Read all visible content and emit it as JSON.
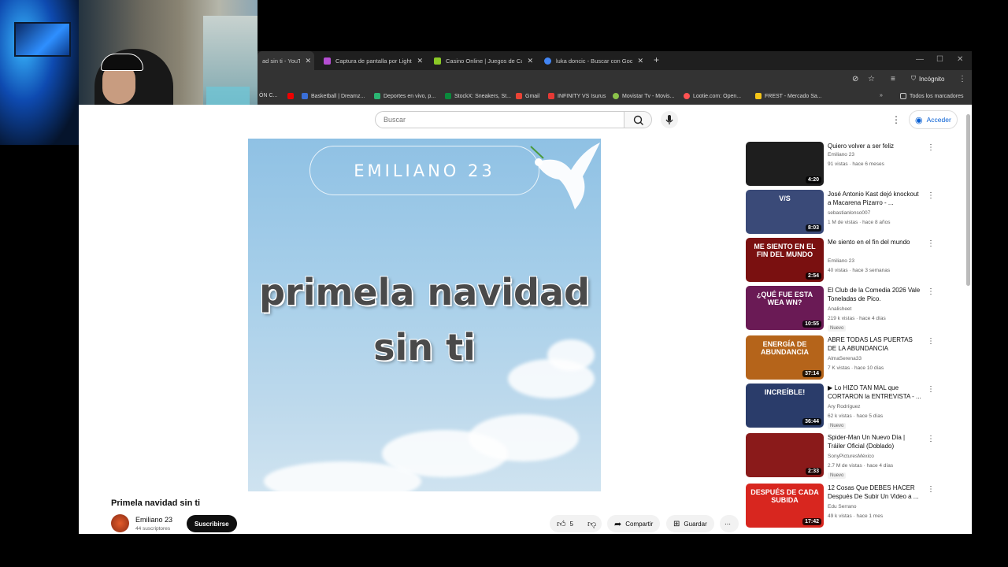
{
  "tabs": [
    {
      "label": "ad sin ti - YouTube",
      "favicon_color": "#ff0000",
      "active": true
    },
    {
      "label": "Captura de pantalla por Lightshot",
      "favicon_color": "#b54ed3",
      "active": false
    },
    {
      "label": "Casino Online | Juegos de Casino",
      "favicon_color": "#8ac926",
      "active": false
    },
    {
      "label": "luka doncic - Buscar con Google",
      "favicon_color": "#4285f4",
      "active": false
    }
  ],
  "incognito_label": "Incógnito",
  "bookmarks": [
    {
      "label": "ÓN C...",
      "color": "#999999"
    },
    {
      "label": "Basketball | Dreamz...",
      "color": "#3a6fd8"
    },
    {
      "label": "Deportes en vivo, p...",
      "color": "#2bb673"
    },
    {
      "label": "StockX: Sneakers, St...",
      "color": "#0a8a3c"
    },
    {
      "label": "Gmail",
      "color": "#ea4335"
    },
    {
      "label": "INFINITY VS Isurus",
      "color": "#e53935"
    },
    {
      "label": "Movistar Tv - Movis...",
      "color": "#8bc34a"
    },
    {
      "label": "Lootie.com: Open...",
      "color": "#ff5252"
    },
    {
      "label": "FREST - Mercado Sa...",
      "color": "#f5c518"
    }
  ],
  "all_bookmarks_label": "Todos los marcadores",
  "search": {
    "placeholder": "Buscar"
  },
  "signin_label": "Acceder",
  "video": {
    "channel_banner": "EMILIANO 23",
    "headline": "primela navidad sin ti",
    "title": "Primela navidad sin ti",
    "channel": "Emiliano 23",
    "subscribers": "44 suscriptores",
    "subscribe_label": "Suscribirse",
    "likes": "5",
    "share_label": "Compartir",
    "save_label": "Guardar"
  },
  "recommendations": [
    {
      "title": "Quiero volver a ser feliz",
      "channel": "Emiliano 23",
      "meta": "91 vistas · hace 6 meses",
      "duration": "4:20",
      "badge": "",
      "thumb_text": "",
      "thumb_bg": "#1e1e1e"
    },
    {
      "title": "José Antonio Kast dejó knockout a Macarena Pizarro - ...",
      "channel": "sebastianlonso007",
      "meta": "1 M de vistas · hace 8 años",
      "duration": "8:03",
      "badge": "",
      "thumb_text": "V/S",
      "thumb_bg": "#3a4a78"
    },
    {
      "title": "Me siento en el fin del mundo",
      "channel": "Emiliano 23",
      "meta": "40 vistas · hace 3 semanas",
      "duration": "2:54",
      "badge": "",
      "thumb_text": "ME SIENTO EN EL FIN DEL MUNDO",
      "thumb_bg": "#7a1010"
    },
    {
      "title": "El Club de la Comedia 2026 Vale Toneladas de Pico.",
      "channel": "Analisheet",
      "meta": "219 k vistas · hace 4 días",
      "duration": "10:55",
      "badge": "Nuevo",
      "thumb_text": "¿QUÉ FUE ESTA WEA WN?",
      "thumb_bg": "#6a1a55"
    },
    {
      "title": "ABRE TODAS LAS PUERTAS DE LA ABUNDANCIA FRECUENCI...",
      "channel": "AlmaSerena33",
      "meta": "7 K vistas · hace 10 días",
      "duration": "37:14",
      "badge": "",
      "thumb_text": "ENERGÍA DE ABUNDANCIA",
      "thumb_bg": "#b5641a"
    },
    {
      "title": "▶ Lo HIZO TAN MAL que CORTARON la ENTREVISTA - ...",
      "channel": "Ary Rodríguez",
      "meta": "62 k vistas · hace 5 días",
      "duration": "36:44",
      "badge": "Nuevo",
      "thumb_text": "INCREÍBLE!",
      "thumb_bg": "#2a3c6a"
    },
    {
      "title": "Spider-Man Un Nuevo Día | Tráiler Oficial (Doblado)",
      "channel": "SonyPicturesMéxico",
      "meta": "2.7 M de vistas · hace 4 días",
      "duration": "2:33",
      "badge": "Nuevo",
      "thumb_text": "",
      "thumb_bg": "#8a1a1a"
    },
    {
      "title": "12 Cosas Que DEBES HACER Después De Subir Un Video a ...",
      "channel": "Edu Serrano",
      "meta": "49 k vistas · hace 1 mes",
      "duration": "17:42",
      "badge": "",
      "thumb_text": "DESPUÉS DE CADA SUBIDA",
      "thumb_bg": "#d8261f"
    }
  ]
}
